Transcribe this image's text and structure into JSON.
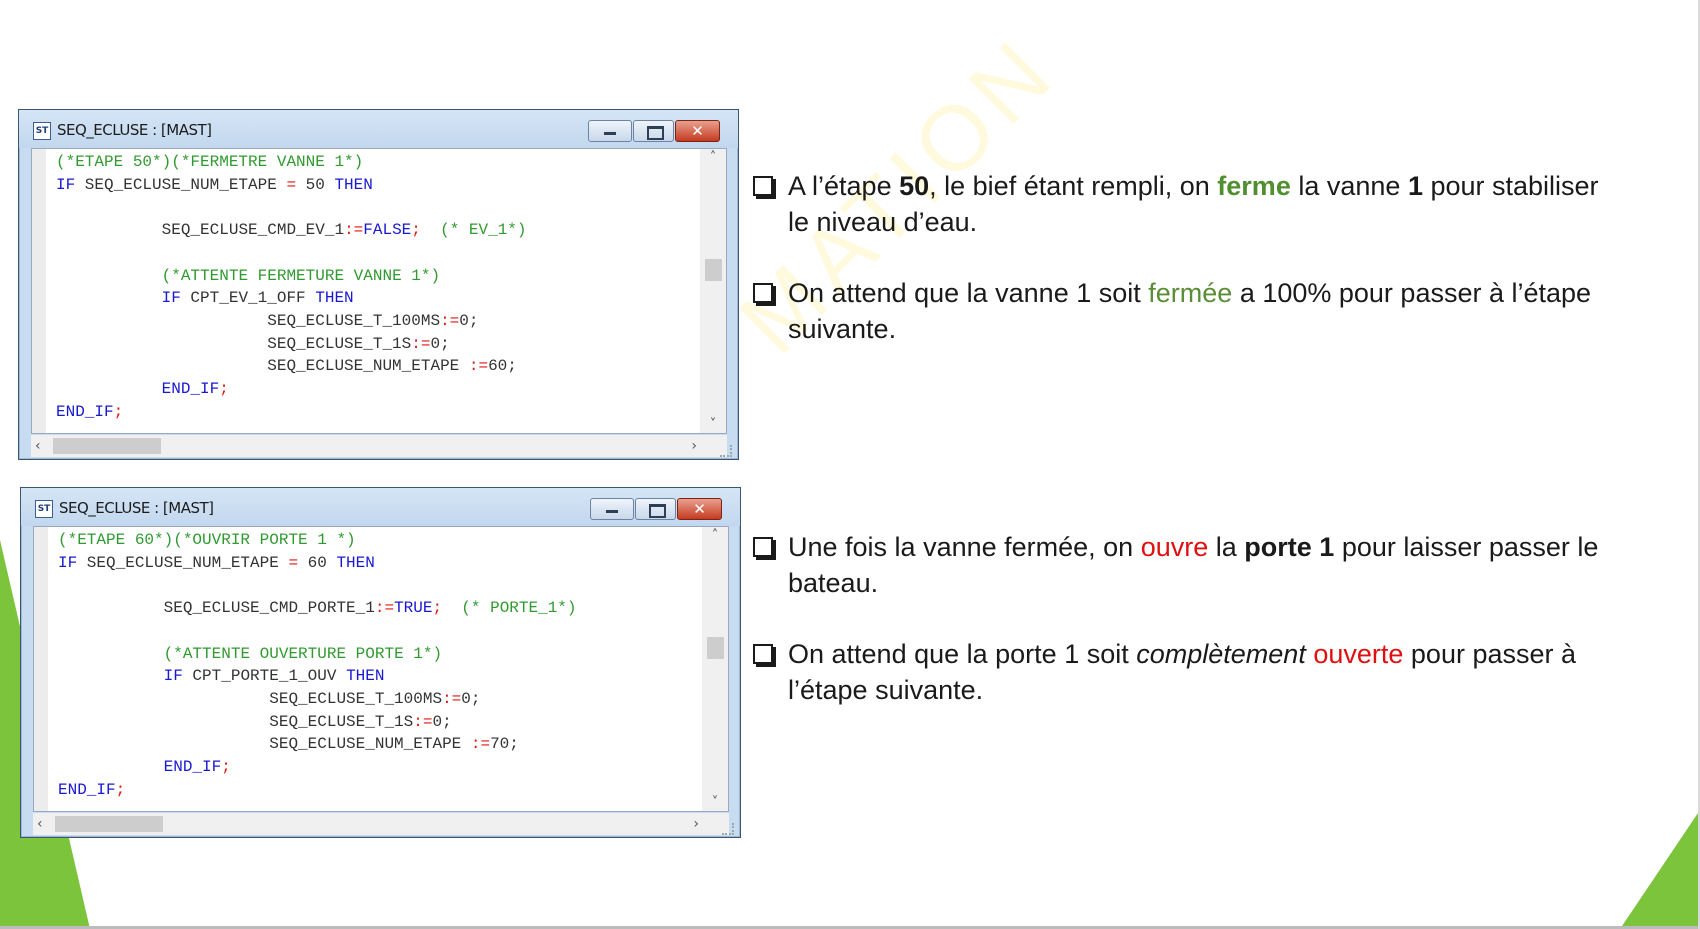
{
  "windows": [
    {
      "title": "SEQ_ECLUSE : [MAST]",
      "icon": "st-icon",
      "icon_label": "ST",
      "close_glyph": "✕",
      "lines": {
        "l1": "(*ETAPE 50*)(*FERMETRE VANNE 1*)",
        "l2_kw": "IF",
        "l2_id": " SEQ_ECLUSE_NUM_ETAPE ",
        "l2_op": "=",
        "l2_num": " 50 ",
        "l2_kw2": "THEN",
        "l4_id": "SEQ_ECLUSE_CMD_EV_1",
        "l4_op": ":=",
        "l4_kw": "FALSE",
        "l4_semi": ";",
        "l4_com": "(* EV_1*)",
        "l6_com": "(*ATTENTE FERMETURE VANNE 1*)",
        "l7_kw": "IF",
        "l7_id": " CPT_EV_1_OFF ",
        "l7_kw2": "THEN",
        "l8_id": "SEQ_ECLUSE_T_100MS",
        "l8_op": ":=",
        "l8_rest": "0;",
        "l9_id": "SEQ_ECLUSE_T_1S",
        "l9_op": ":=",
        "l9_rest": "0;",
        "l10_id": "SEQ_ECLUSE_NUM_ETAPE ",
        "l10_op": ":=",
        "l10_rest": "60;",
        "l11_kw": "END_IF",
        "l11_semi": ";",
        "l12_kw": "END_IF",
        "l12_semi": ";"
      }
    },
    {
      "title": "SEQ_ECLUSE : [MAST]",
      "icon": "st-icon",
      "icon_label": "ST",
      "close_glyph": "✕",
      "lines": {
        "l1": "(*ETAPE 60*)(*OUVRIR PORTE 1 *)",
        "l2_kw": "IF",
        "l2_id": " SEQ_ECLUSE_NUM_ETAPE ",
        "l2_op": "=",
        "l2_num": " 60 ",
        "l2_kw2": "THEN",
        "l4_id": "SEQ_ECLUSE_CMD_PORTE_1",
        "l4_op": ":=",
        "l4_kw": "TRUE",
        "l4_semi": ";",
        "l4_com": "(* PORTE_1*)",
        "l6_com": "(*ATTENTE OUVERTURE PORTE 1*)",
        "l7_kw": "IF",
        "l7_id": " CPT_PORTE_1_OUV ",
        "l7_kw2": "THEN",
        "l8_id": "SEQ_ECLUSE_T_100MS",
        "l8_op": ":=",
        "l8_rest": "0;",
        "l9_id": "SEQ_ECLUSE_T_1S",
        "l9_op": ":=",
        "l9_rest": "0;",
        "l10_id": "SEQ_ECLUSE_NUM_ETAPE ",
        "l10_op": ":=",
        "l10_rest": "70;",
        "l11_kw": "END_IF",
        "l11_semi": ";",
        "l12_kw": "END_IF",
        "l12_semi": ";"
      }
    }
  ],
  "bullets": {
    "b1": {
      "t1": "A l’étape ",
      "t2": "50",
      "t3": ", le bief étant rempli, on ",
      "t4": "ferme",
      "t5": " la vanne ",
      "t6": "1",
      "t7": " pour stabiliser le niveau d’eau."
    },
    "b2": {
      "t1": "On attend que la vanne 1 soit ",
      "t2": "fermée",
      "t3": " a 100% pour passer à l’étape suivante."
    },
    "b3": {
      "t1": "Une fois la vanne fermée, on ",
      "t2": "ouvre",
      "t3": " la ",
      "t4": "porte 1",
      "t5": " pour laisser passer le bateau."
    },
    "b4": {
      "t1": "On attend que la porte 1 soit ",
      "t2": "complètement",
      "t3": " ",
      "t4": "ouverte",
      "t5": " pour passer à l’étape suivante."
    }
  },
  "watermark": "MATION   OUEST",
  "colors": {
    "accent_green": "#4f8f2f",
    "deco_green": "#7cc43b",
    "highlight_red": "#e01010",
    "code_comment": "#2f9a2f",
    "code_keyword": "#1919d2",
    "code_operator": "#e01616",
    "window_chrome": "#c7dbf1"
  }
}
